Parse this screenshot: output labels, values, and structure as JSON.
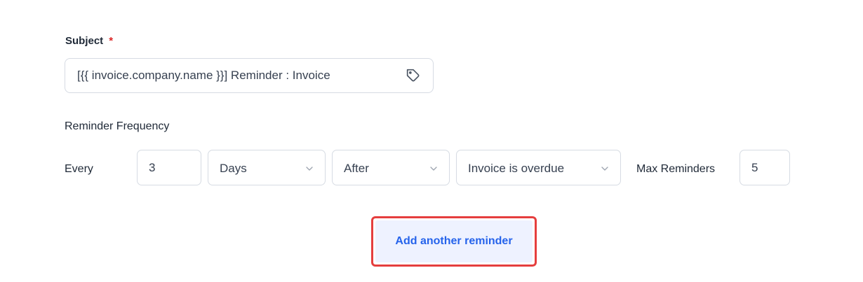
{
  "subject": {
    "label": "Subject",
    "required_marker": "*",
    "value": "[{{ invoice.company.name }}] Reminder : Invoice",
    "icon": "tag-icon"
  },
  "reminder": {
    "frequency_label": "Reminder Frequency",
    "every_label": "Every",
    "interval_value": "3",
    "unit_select": {
      "selected": "Days",
      "icon": "chevron-down-icon"
    },
    "timing_select": {
      "selected": "After",
      "icon": "chevron-down-icon"
    },
    "event_select": {
      "selected": "Invoice is overdue",
      "icon": "chevron-down-icon"
    },
    "max_label": "Max Reminders",
    "max_value": "5"
  },
  "actions": {
    "add_label": "Add another reminder"
  },
  "colors": {
    "required": "#dc2626",
    "accent": "#2563eb",
    "highlight_border": "#e53e3e",
    "button_bg": "#eef2ff",
    "input_border": "#d6dbe3"
  }
}
